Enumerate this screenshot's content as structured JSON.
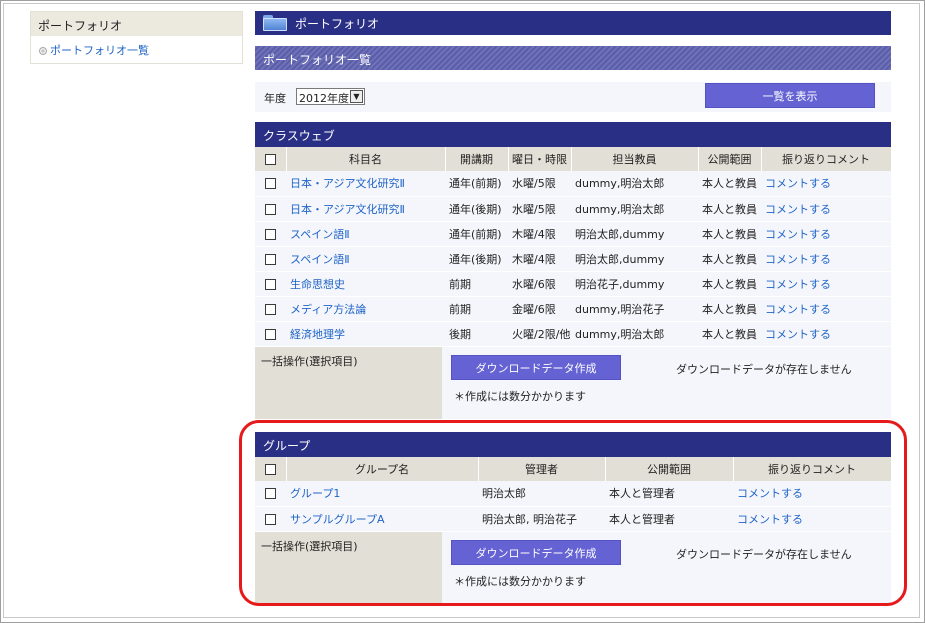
{
  "sidebar": {
    "title": "ポートフォリオ",
    "items": [
      {
        "label": "ポートフォリオ一覧"
      }
    ]
  },
  "header": {
    "title": "ポートフォリオ",
    "subtitle": "ポートフォリオ一覧"
  },
  "filter": {
    "year_label": "年度",
    "year_value": "2012年度",
    "show_button": "一覧を表示"
  },
  "classweb": {
    "title": "クラスウェブ",
    "columns": [
      "科目名",
      "開講期",
      "曜日・時限",
      "担当教員",
      "公開範囲",
      "振り返りコメント"
    ],
    "rows": [
      {
        "name": "日本・アジア文化研究Ⅱ",
        "term": "通年(前期)",
        "time": "水曜/5限",
        "teacher": "dummy,明治太郎",
        "scope": "本人と教員",
        "comment": "コメントする"
      },
      {
        "name": "日本・アジア文化研究Ⅱ",
        "term": "通年(後期)",
        "time": "水曜/5限",
        "teacher": "dummy,明治太郎",
        "scope": "本人と教員",
        "comment": "コメントする"
      },
      {
        "name": "スペイン語Ⅱ",
        "term": "通年(前期)",
        "time": "木曜/4限",
        "teacher": "明治太郎,dummy",
        "scope": "本人と教員",
        "comment": "コメントする"
      },
      {
        "name": "スペイン語Ⅱ",
        "term": "通年(後期)",
        "time": "木曜/4限",
        "teacher": "明治太郎,dummy",
        "scope": "本人と教員",
        "comment": "コメントする"
      },
      {
        "name": "生命思想史",
        "term": "前期",
        "time": "水曜/6限",
        "teacher": "明治花子,dummy",
        "scope": "本人と教員",
        "comment": "コメントする"
      },
      {
        "name": "メディア方法論",
        "term": "前期",
        "time": "金曜/6限",
        "teacher": "dummy,明治花子",
        "scope": "本人と教員",
        "comment": "コメントする"
      },
      {
        "name": "経済地理学",
        "term": "後期",
        "time": "火曜/2限/他",
        "teacher": "dummy,明治太郎",
        "scope": "本人と教員",
        "comment": "コメントする"
      }
    ],
    "bulk": {
      "label": "一括操作(選択項目)",
      "download_button": "ダウンロードデータ作成",
      "status": "ダウンロードデータが存在しません",
      "note": "＊作成には数分かかります"
    }
  },
  "group": {
    "title": "グループ",
    "columns": [
      "グループ名",
      "管理者",
      "公開範囲",
      "振り返りコメント"
    ],
    "rows": [
      {
        "name": "グループ1",
        "admin": "明治太郎",
        "scope": "本人と管理者",
        "comment": "コメントする"
      },
      {
        "name": "サンプルグループA",
        "admin": "明治太郎, 明治花子",
        "scope": "本人と管理者",
        "comment": "コメントする"
      }
    ],
    "bulk": {
      "label": "一括操作(選択項目)",
      "download_button": "ダウンロードデータ作成",
      "status": "ダウンロードデータが存在しません",
      "note": "＊作成には数分かかります"
    }
  },
  "colors": {
    "header_bg": "#2a2f86",
    "button_bg": "#6563d3",
    "link": "#1e64c8",
    "highlight": "#e61a1a"
  }
}
